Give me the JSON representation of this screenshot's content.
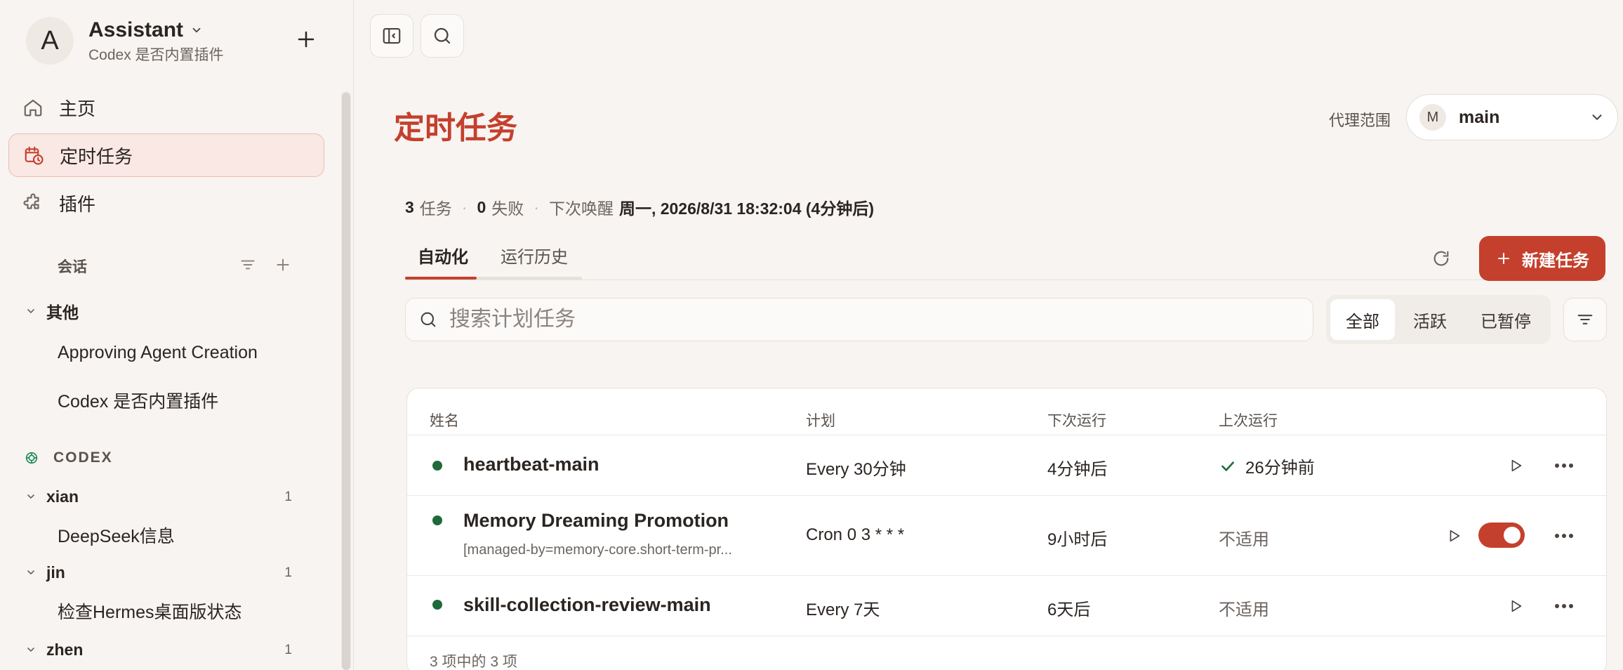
{
  "workspace": {
    "initial": "A",
    "name": "Assistant",
    "subtitle": "Codex 是否内置插件"
  },
  "nav": [
    {
      "label": "主页",
      "icon": "home-icon"
    },
    {
      "label": "定时任务",
      "icon": "calendar-clock-icon",
      "active": true
    },
    {
      "label": "插件",
      "icon": "puzzle-icon"
    }
  ],
  "sessions": {
    "label": "会话",
    "groups": [
      {
        "name": "其他",
        "items": [
          "Approving Agent Creation",
          "Codex 是否内置插件"
        ]
      }
    ]
  },
  "codex": {
    "label": "CODEX",
    "groups": [
      {
        "name": "xian",
        "count": "1",
        "items": [
          "DeepSeek信息"
        ]
      },
      {
        "name": "jin",
        "count": "1",
        "items": [
          "检查Hermes桌面版状态"
        ]
      },
      {
        "name": "zhen",
        "count": "1",
        "items": []
      }
    ]
  },
  "header": {
    "title": "定时任务",
    "scope_label": "代理范围",
    "scope_initial": "M",
    "scope_value": "main"
  },
  "stats": {
    "tasks_count": "3",
    "tasks_label": "任务",
    "failed_count": "0",
    "failed_label": "失败",
    "next_label": "下次唤醒",
    "next_value": "周一, 2026/8/31 18:32:04 (4分钟后)"
  },
  "tabs": [
    {
      "label": "自动化",
      "active": true
    },
    {
      "label": "运行历史"
    }
  ],
  "new_task_label": "新建任务",
  "search": {
    "placeholder": "搜索计划任务"
  },
  "segments": [
    {
      "label": "全部",
      "active": true
    },
    {
      "label": "活跃"
    },
    {
      "label": "已暂停"
    }
  ],
  "table": {
    "columns": [
      "姓名",
      "计划",
      "下次运行",
      "上次运行"
    ],
    "rows": [
      {
        "name": "heartbeat-main",
        "desc": "",
        "schedule": "Every 30分钟",
        "next": "4分钟后",
        "last": "26分钟前",
        "last_ok": true
      },
      {
        "name": "Memory Dreaming Promotion",
        "desc": "[managed-by=memory-core.short-term-pr...",
        "schedule": "Cron 0 3 * * *",
        "next": "9小时后",
        "last": "不适用",
        "toggle": true
      },
      {
        "name": "skill-collection-review-main",
        "desc": "",
        "schedule": "Every 7天",
        "next": "6天后",
        "last": "不适用"
      }
    ],
    "footer": "3 项中的 3 项"
  },
  "colors": {
    "accent": "#c4402d",
    "status_active": "#1e6a3a",
    "background": "#f7f4f1"
  }
}
